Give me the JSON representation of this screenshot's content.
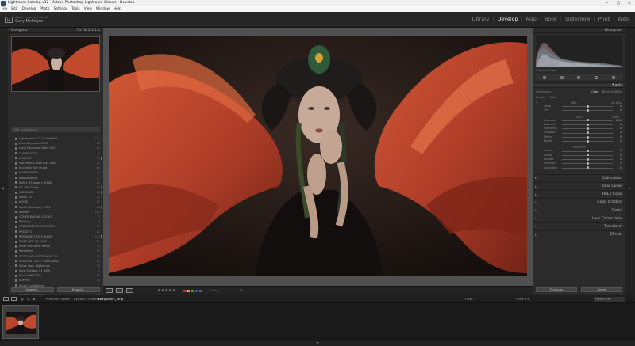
{
  "window": {
    "title": "Lightroom Catalog-v12 - Adobe Photoshop Lightroom Classic - Develop",
    "controls": [
      "–",
      "▢",
      "✕"
    ]
  },
  "menu": [
    "File",
    "Edit",
    "Develop",
    "Photo",
    "Settings",
    "Tools",
    "View",
    "Window",
    "Help"
  ],
  "identity": {
    "badge": "Lr",
    "line1": "Adobe Lightroom Classic",
    "line2": "Gary McIntyre"
  },
  "modules": [
    {
      "label": "Library",
      "active": false
    },
    {
      "label": "Develop",
      "active": true
    },
    {
      "label": "Map",
      "active": false
    },
    {
      "label": "Book",
      "active": false
    },
    {
      "label": "Slideshow",
      "active": false
    },
    {
      "label": "Print",
      "active": false
    },
    {
      "label": "Web",
      "active": false
    }
  ],
  "navigator": {
    "title": "Navigator",
    "zoom_options": [
      "Fit",
      "Fill",
      "1:1",
      "1:4"
    ]
  },
  "collections": {
    "search_placeholder": "Filter Collections",
    "items": [
      {
        "name": "Lightroom CLC 22 Wed 8/8",
        "count": "122",
        "flag": ""
      },
      {
        "name": "Long Exposure 1000",
        "count": "18",
        "flag": ""
      },
      {
        "name": "Long Exposure Video 90C",
        "count": "44",
        "flag": ""
      },
      {
        "name": "LOOPY 2022",
        "count": "9",
        "flag": ""
      },
      {
        "name": "LUXIOUS",
        "count": "31",
        "flag": "#3a9a3a"
      },
      {
        "name": "Marvellous Look KIM 1080",
        "count": "15",
        "flag": ""
      },
      {
        "name": "McGrady Bay Shoot",
        "count": "60",
        "flag": ""
      },
      {
        "name": "MOVIE VIDEO",
        "count": "8",
        "flag": ""
      },
      {
        "name": "Nanochrome",
        "count": "27",
        "flag": ""
      },
      {
        "name": "NIGEL RF gallery SHAW",
        "count": "11",
        "flag": ""
      },
      {
        "name": "NC Still Shoot",
        "count": "36",
        "flag": "#c03030"
      },
      {
        "name": "NIKON Z6",
        "count": "14",
        "flag": "#c03030"
      },
      {
        "name": "Nikon Z5",
        "count": "20",
        "flag": ""
      },
      {
        "name": "NOISE",
        "count": "12",
        "flag": ""
      },
      {
        "name": "North Wales July 2021",
        "count": "46",
        "flag": "#c03030"
      },
      {
        "name": "Norway",
        "count": "144",
        "flag": ""
      },
      {
        "name": "OTHER DRONE LICENCE",
        "count": "3",
        "flag": ""
      },
      {
        "name": "Pantone",
        "count": "9",
        "flag": ""
      },
      {
        "name": "PORTRAITS FROM STOCK",
        "count": "50",
        "flag": ""
      },
      {
        "name": "PRESETS",
        "count": "22",
        "flag": ""
      },
      {
        "name": "REGRADE THIS FOLDER",
        "count": "107",
        "flag": "#3a9a3a"
      },
      {
        "name": "RIVER BRT 90 2022",
        "count": "17",
        "flag": ""
      },
      {
        "name": "River Run Walk March",
        "count": "8",
        "flag": ""
      },
      {
        "name": "Sandman",
        "count": "29",
        "flag": ""
      },
      {
        "name": "SCOTLAND POSTCARDS 20",
        "count": "13",
        "flag": ""
      },
      {
        "name": "SESSION - SCOTT WILLIAMS",
        "count": "41",
        "flag": ""
      },
      {
        "name": "Skies Use - Highlands",
        "count": "23",
        "flag": ""
      },
      {
        "name": "Slow October 21 RAW",
        "count": "5",
        "flag": ""
      },
      {
        "name": "Slow PAW 2020",
        "count": "38",
        "flag": ""
      },
      {
        "name": "SUPER7",
        "count": "19",
        "flag": ""
      },
      {
        "name": "Smart Collections",
        "count": "",
        "flag": ""
      },
      {
        "name": "Softermastership1",
        "count": "4",
        "flag": ""
      },
      {
        "name": "ST FYW JAZZ 2019",
        "count": "32",
        "flag": ""
      },
      {
        "name": "Subs test files",
        "count": "7",
        "flag": ""
      },
      {
        "name": "TALK IN BAR MID NEAR",
        "count": "16",
        "flag": ""
      }
    ]
  },
  "left_buttons": {
    "import": "Import...",
    "export": "Export..."
  },
  "histogram": {
    "title": "Histogram",
    "iso": "ISO 200",
    "focal": "24 mm",
    "aperture": "f / 2.8",
    "original_label": "Original Photo"
  },
  "basic": {
    "title": "Basic",
    "treatment_label": "Treatment :",
    "color_label": "Color",
    "bw_label": "Black & White",
    "profile_label": "Profile :",
    "profile_value": "Color",
    "wb_label": "WB :",
    "wb_value": "As Shot",
    "tone_label": "Tone",
    "auto_label": "Auto",
    "presence_label": "Presence",
    "sliders": [
      {
        "label": "Temp",
        "value": "0",
        "pos": 0.5
      },
      {
        "label": "Tint",
        "value": "0",
        "pos": 0.5
      },
      {
        "label": "Exposure",
        "value": "0.00",
        "pos": 0.5
      },
      {
        "label": "Contrast",
        "value": "0",
        "pos": 0.5
      },
      {
        "label": "Highlights",
        "value": "0",
        "pos": 0.5
      },
      {
        "label": "Shadows",
        "value": "0",
        "pos": 0.5
      },
      {
        "label": "Whites",
        "value": "0",
        "pos": 0.5
      },
      {
        "label": "Blacks",
        "value": "0",
        "pos": 0.5
      },
      {
        "label": "Texture",
        "value": "0",
        "pos": 0.5
      },
      {
        "label": "Clarity",
        "value": "0",
        "pos": 0.5
      },
      {
        "label": "Dehaze",
        "value": "0",
        "pos": 0.5
      },
      {
        "label": "Vibrance",
        "value": "0",
        "pos": 0.5
      },
      {
        "label": "Saturation",
        "value": "0",
        "pos": 0.5
      }
    ]
  },
  "sections": [
    "Calibration",
    "Tone Curve",
    "HSL / Color",
    "Color Grading",
    "Detail",
    "Lens Corrections",
    "Transform",
    "Effects"
  ],
  "right_buttons": {
    "previous": "Previous",
    "reset": "Reset"
  },
  "toolbar": {
    "stars": "★★★★★",
    "zoom_label": "Zoom",
    "zoom_value": "Fit"
  },
  "filmstrip_bar": {
    "source": "Previous Import",
    "count": "1 photo / 1 selected /",
    "filename": "Filmpapers_.dng",
    "filter_label": "Filter :",
    "filter_value": "Filters Off"
  },
  "filmstrip": {
    "thumb_number": "1"
  },
  "colors": {
    "accent": "#e8e8e8",
    "panel": "#2b2b2b",
    "background": "#1a1a1a",
    "fabric": "#c84a2a"
  }
}
